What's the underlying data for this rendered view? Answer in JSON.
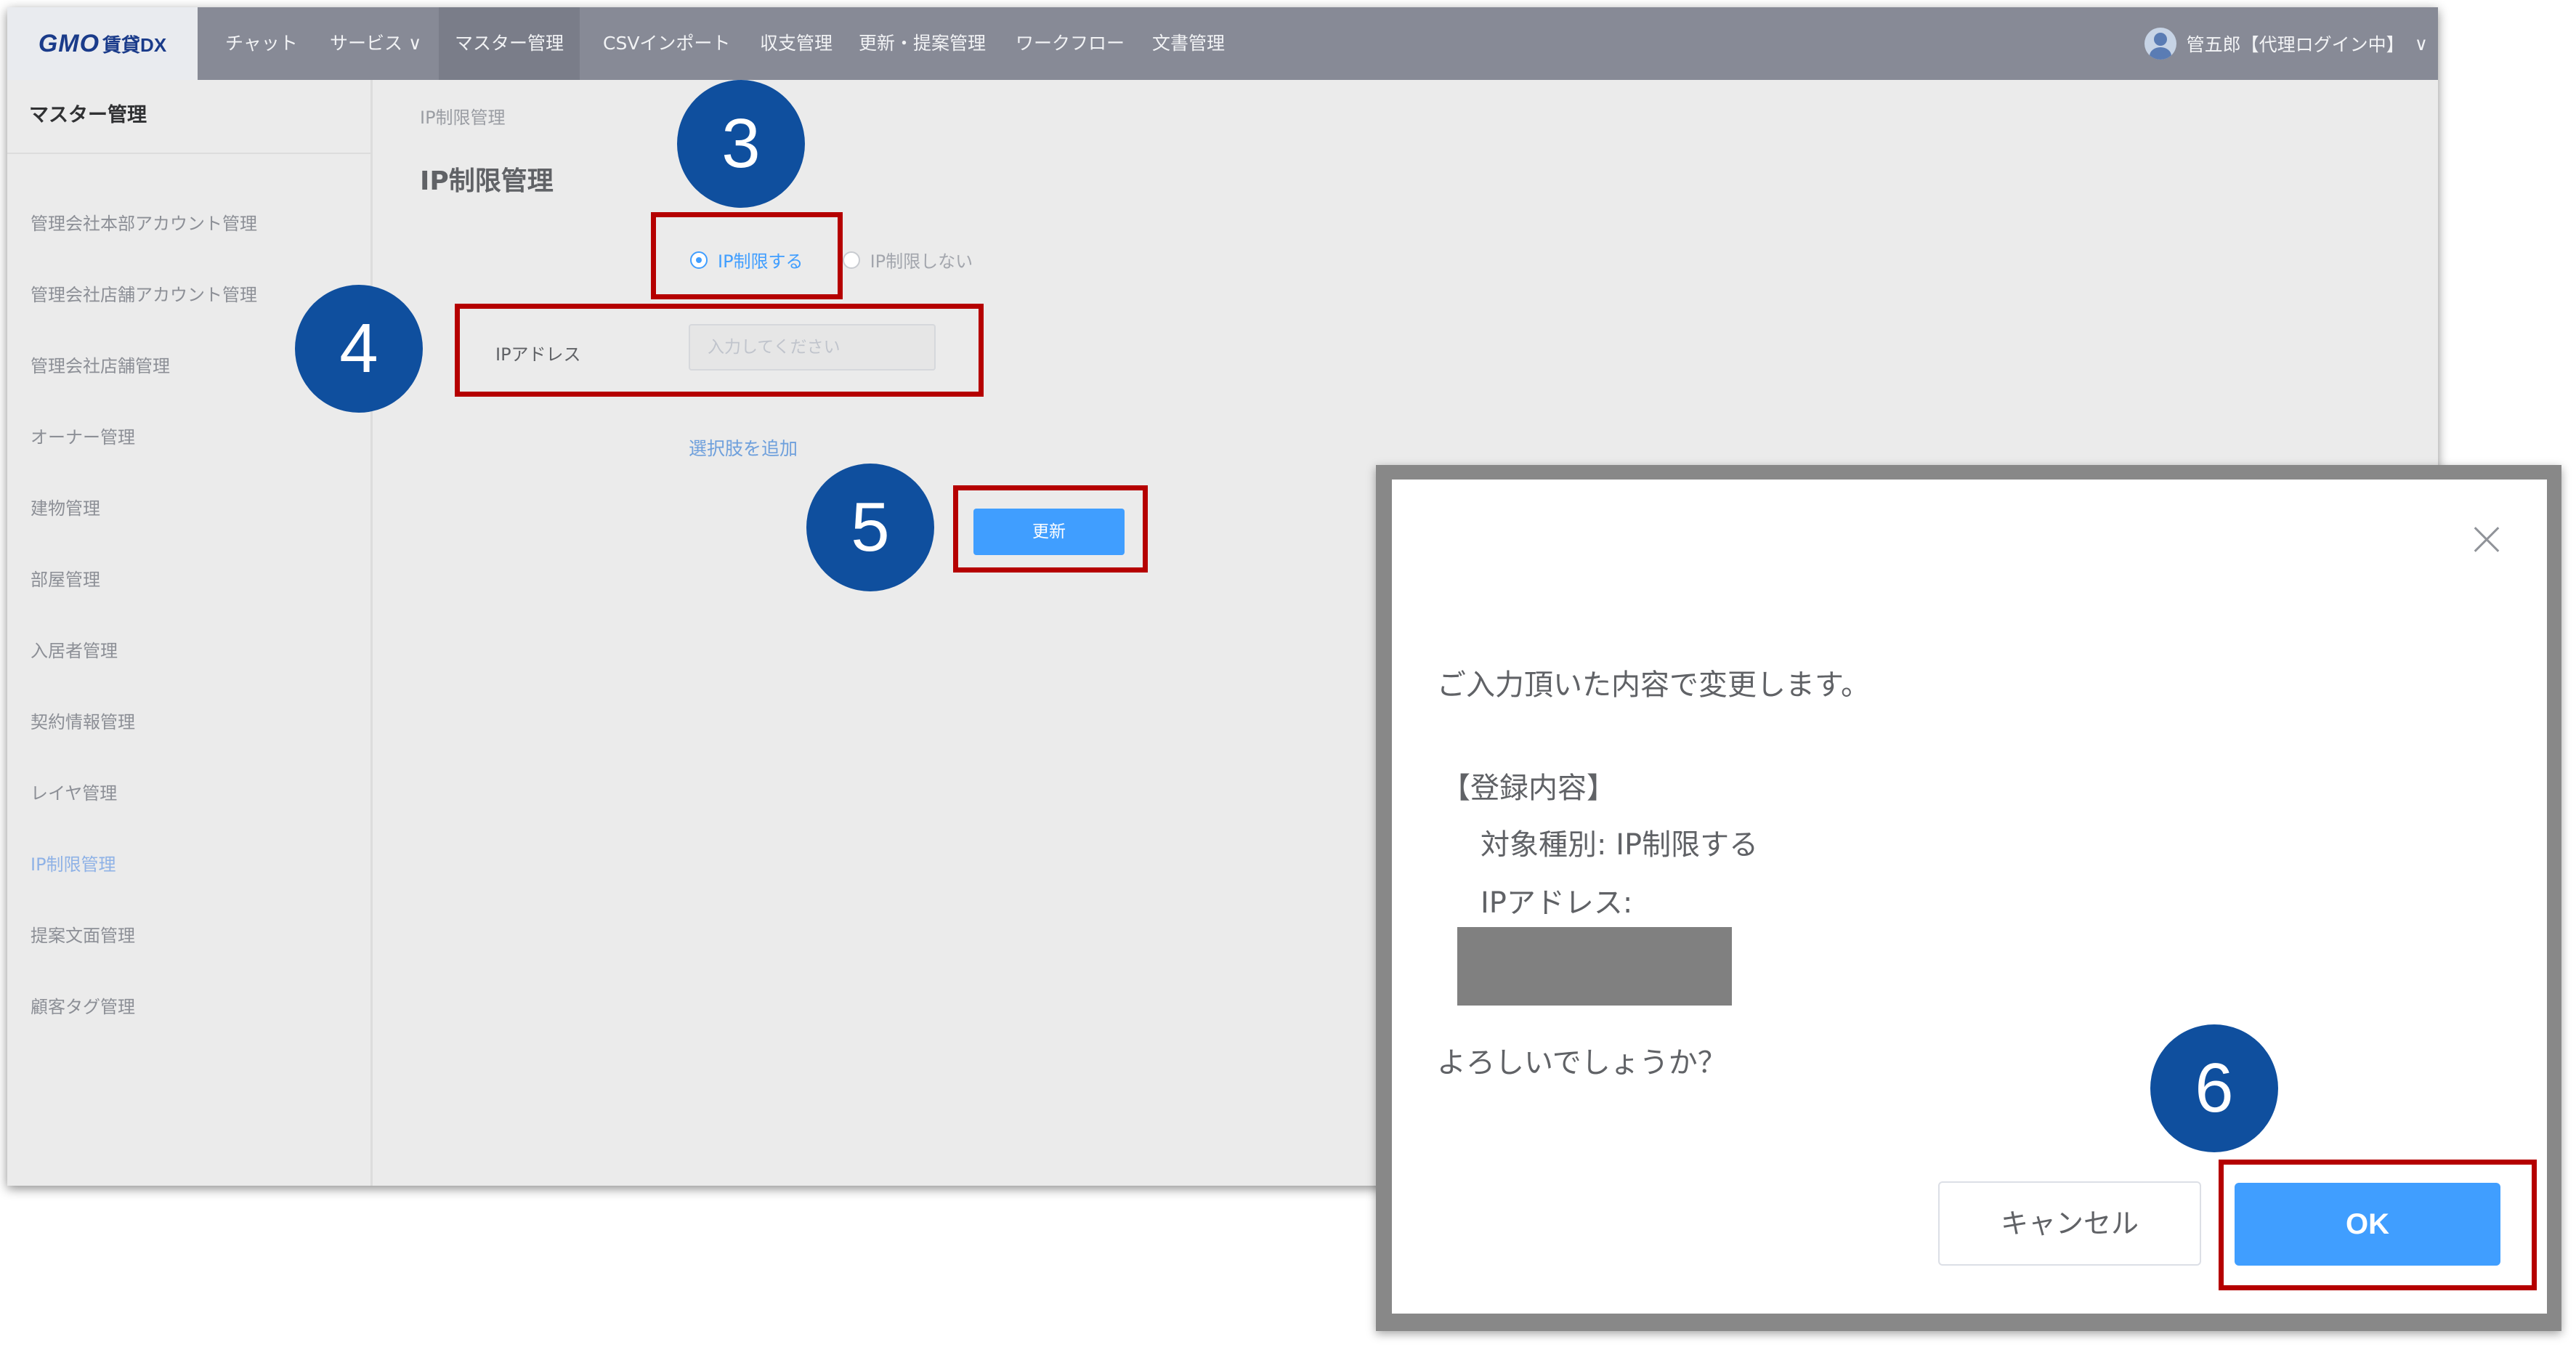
{
  "header": {
    "logo_brand": "GMO",
    "logo_product": "賃貸DX",
    "nav": [
      "チャット",
      "サービス ∨",
      "マスター管理",
      "CSVインポート",
      "収支管理",
      "更新・提案管理",
      "ワークフロー",
      "文書管理"
    ],
    "user_label": "管五郎【代理ログイン中】",
    "user_chevron": "∨"
  },
  "sidebar": {
    "title": "マスター管理",
    "items": [
      {
        "label": "管理会社本部アカウント管理"
      },
      {
        "label": "管理会社店舗アカウント管理"
      },
      {
        "label": "管理会社店舗管理"
      },
      {
        "label": "オーナー管理"
      },
      {
        "label": "建物管理"
      },
      {
        "label": "部屋管理"
      },
      {
        "label": "入居者管理"
      },
      {
        "label": "契約情報管理"
      },
      {
        "label": "レイヤ管理"
      },
      {
        "label": "IP制限管理",
        "active": true
      },
      {
        "label": "提案文面管理"
      },
      {
        "label": "顧客タグ管理"
      }
    ]
  },
  "main": {
    "breadcrumb": "IP制限管理",
    "title": "IP制限管理",
    "radio_options": [
      "IP制限する",
      "IP制限しない"
    ],
    "radio_selected": "IP制限する",
    "ip_label": "IPアドレス",
    "ip_placeholder": "入力してください",
    "add_option_link": "選択肢を追加",
    "update_button": "更新",
    "stray_char": "5",
    "stray_char_2": "]"
  },
  "badges": [
    "3",
    "4",
    "5",
    "6"
  ],
  "dialog": {
    "message": "ご入力頂いた内容で変更します。",
    "section_title": "【登録内容】",
    "target_type": "対象種別: IP制限する",
    "ip_address_label": "IPアドレス:",
    "confirm_question": "よろしいでしょうか？",
    "cancel_button": "キャンセル",
    "ok_button": "OK"
  },
  "colors": {
    "nav_bg": "#878a96",
    "accent_blue": "#409eff",
    "badge_blue": "#0f4f9e",
    "highlight_red": "#b50000"
  }
}
